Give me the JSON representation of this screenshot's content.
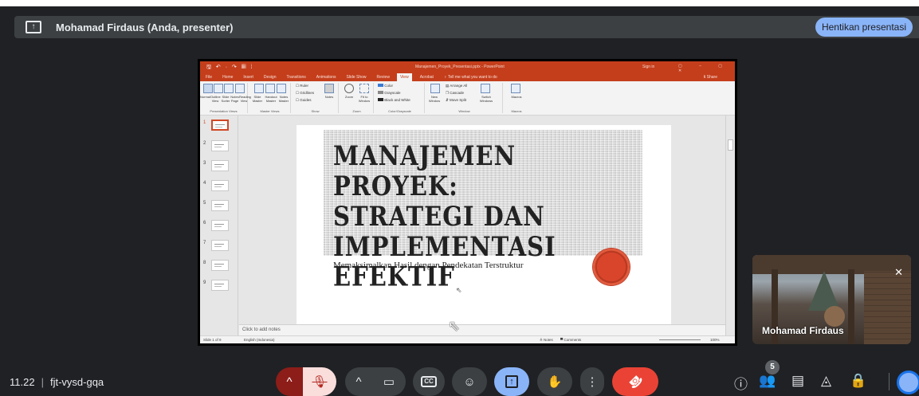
{
  "header": {
    "presenter_label": "Mohamad Firdaus (Anda, presenter)",
    "stop_button": "Hentikan presentasi",
    "present_icon_glyph": "↑"
  },
  "powerpoint": {
    "title_bar": {
      "quick_access": "🖫 ↶ · ↷ ▦ ⁞",
      "document_title": "Manajemen_Proyek_Presentasi.pptx - PowerPoint",
      "sign_in": "Sign in",
      "window_buttons": "▢ – ▢ ✕"
    },
    "menu": {
      "tabs": [
        "File",
        "Home",
        "Insert",
        "Design",
        "Transitions",
        "Animations",
        "Slide Show",
        "Review"
      ],
      "active_tab": "View",
      "after_tabs": [
        "Acrobat",
        "♀ Tell me what you want to do"
      ],
      "share": "ꝸ Share"
    },
    "ribbon": {
      "presentation_views": {
        "label": "Presentation Views",
        "items": [
          "Normal",
          "Outline View",
          "Slide Sorter",
          "Notes Page",
          "Reading View"
        ]
      },
      "master_views": {
        "label": "Master Views",
        "items": [
          "Slide Master",
          "Handout Master",
          "Notes Master"
        ]
      },
      "show": {
        "label": "Show",
        "checks": [
          "Ruler",
          "Gridlines",
          "Guides"
        ],
        "notes": "Notes"
      },
      "zoom": {
        "label": "Zoom",
        "items": [
          "Zoom",
          "Fit to Window"
        ]
      },
      "color": {
        "label": "Color/Grayscale",
        "items": [
          "Color",
          "Grayscale",
          "Black and White"
        ]
      },
      "window": {
        "label": "Window",
        "items": [
          "New Window",
          "Arrange All",
          "Cascade",
          "Move Split",
          "Switch Windows"
        ]
      },
      "macros": {
        "label": "Macros",
        "items": [
          "Macros"
        ]
      }
    },
    "thumbnails": [
      "1",
      "2",
      "3",
      "4",
      "5",
      "6",
      "7",
      "8",
      "9"
    ],
    "slide": {
      "title_line1": "MANAJEMEN PROYEK:",
      "title_line2": "STRATEGI DAN",
      "title_line3": "IMPLEMENTASI EFEKTIF",
      "subtitle": "Memaksimalkan Hasil dengan Pendekatan Terstruktur"
    },
    "notes_placeholder": "Click to add notes",
    "status": {
      "slide_count": "Slide 1 of 9",
      "language": "English (Indonesia)",
      "notes": "≙ Notes",
      "comments": "▀ Comments",
      "zoom": "100%"
    }
  },
  "self_tile": {
    "name": "Mohamad Firdaus",
    "mic_icon": "✕"
  },
  "footer": {
    "time": "11.22",
    "meeting_code": "fjt-vysd-gqa",
    "participants_count": "5",
    "controls": {
      "caret_up": "^",
      "mic": "🎙",
      "camera": "▭",
      "captions": "CC",
      "emoji": "☺",
      "present": "↑",
      "hand": "✋",
      "more": "⋮",
      "end_call": "☎"
    },
    "right_icons": {
      "info": "ⓘ",
      "people": "👥",
      "chat": "▤",
      "activities": "◬",
      "host": "🔒"
    }
  }
}
